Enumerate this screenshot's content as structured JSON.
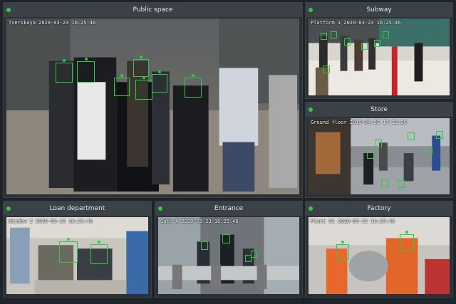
{
  "theme": {
    "background": "#1f2428",
    "panel_bg": "#2b3136",
    "header_bg": "#3a4147",
    "detection_color": "#2ecc40",
    "header_text": "#e6e9ec"
  },
  "panels": {
    "public_space": {
      "title": "Public space",
      "timestamp": "Tverskaya 2020-03-23  16:25:46"
    },
    "subway": {
      "title": "Subway",
      "timestamp": "Platform 1 2020-03-23  16:25:46"
    },
    "store": {
      "title": "Store",
      "timestamp": "Ground floor 2019-04-23  17:13:20"
    },
    "loan": {
      "title": "Loan department",
      "timestamp": "Window 2 2020-03-23  16:25:46"
    },
    "entrance": {
      "title": "Entrance",
      "timestamp": "Gate A 2020-03-23  16:25:46"
    },
    "factory": {
      "title": "Factory",
      "timestamp": "Plant 01 2020-03-23  16:25:46"
    }
  },
  "icons": {
    "status_dot": "status-dot-icon",
    "face_box": "face-detection-box"
  }
}
